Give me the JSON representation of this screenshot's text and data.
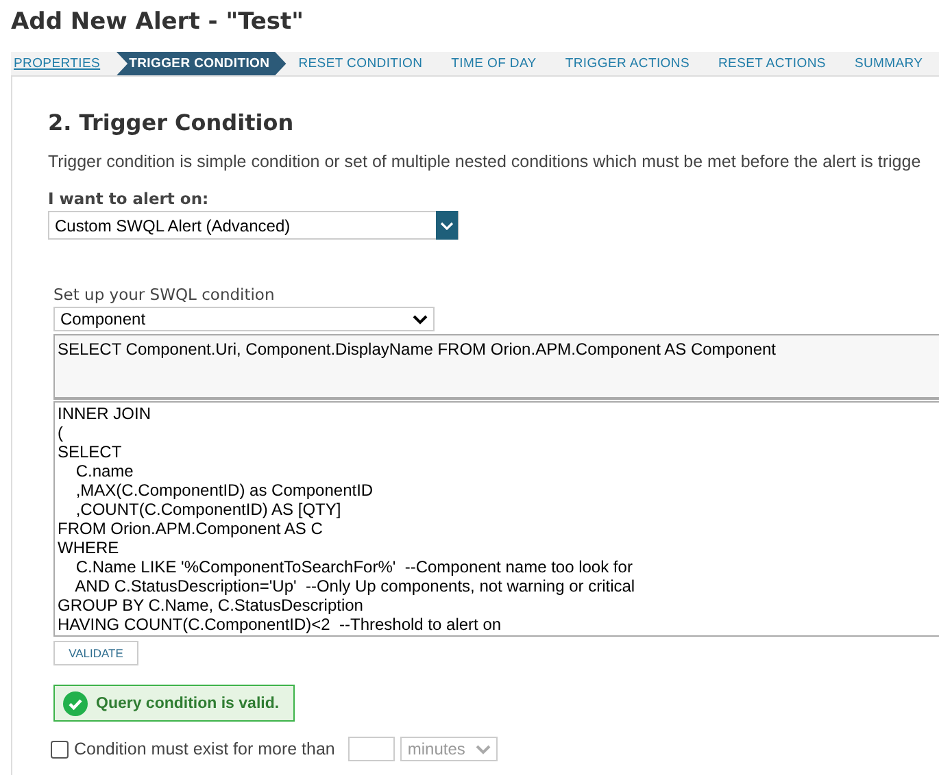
{
  "page_title": "Add New Alert - \"Test\"",
  "steps": [
    {
      "label": "PROPERTIES",
      "selected": false,
      "completed": true
    },
    {
      "label": "TRIGGER CONDITION",
      "selected": true,
      "completed": false
    },
    {
      "label": "RESET CONDITION",
      "selected": false,
      "completed": false
    },
    {
      "label": "TIME OF DAY",
      "selected": false,
      "completed": false
    },
    {
      "label": "TRIGGER ACTIONS",
      "selected": false,
      "completed": false
    },
    {
      "label": "RESET ACTIONS",
      "selected": false,
      "completed": false
    },
    {
      "label": "SUMMARY",
      "selected": false,
      "completed": false
    }
  ],
  "section_title": "2. Trigger Condition",
  "description": "Trigger condition is simple condition or set of multiple nested conditions which must be met before the alert is trigge",
  "alert_on": {
    "label": "I want to alert on:",
    "value": "Custom SWQL Alert (Advanced)"
  },
  "swql": {
    "label": "Set up your SWQL condition",
    "object_type": "Component",
    "select_query": "SELECT Component.Uri, Component.DisplayName FROM Orion.APM.Component AS Component",
    "condition_lines": [
      "INNER JOIN",
      "(",
      "SELECT",
      "    C.name",
      "    ,MAX(C.ComponentID) as ComponentID",
      "    ,COUNT(C.ComponentID) AS [QTY]",
      "FROM Orion.APM.Component AS C",
      "WHERE",
      "    C.Name LIKE '%ComponentToSearchFor%'  --Component name too look for",
      "    AND C.StatusDescription='Up'  --Only Up components, not warning or critical",
      "GROUP BY C.Name, C.StatusDescription",
      "HAVING COUNT(C.ComponentID)<2  --Threshold to alert on"
    ]
  },
  "validate_button": "VALIDATE",
  "validation": {
    "valid": true,
    "message": "Query condition is valid."
  },
  "duration": {
    "label": "Condition must exist for more than",
    "checked": false,
    "unit": "minutes"
  }
}
